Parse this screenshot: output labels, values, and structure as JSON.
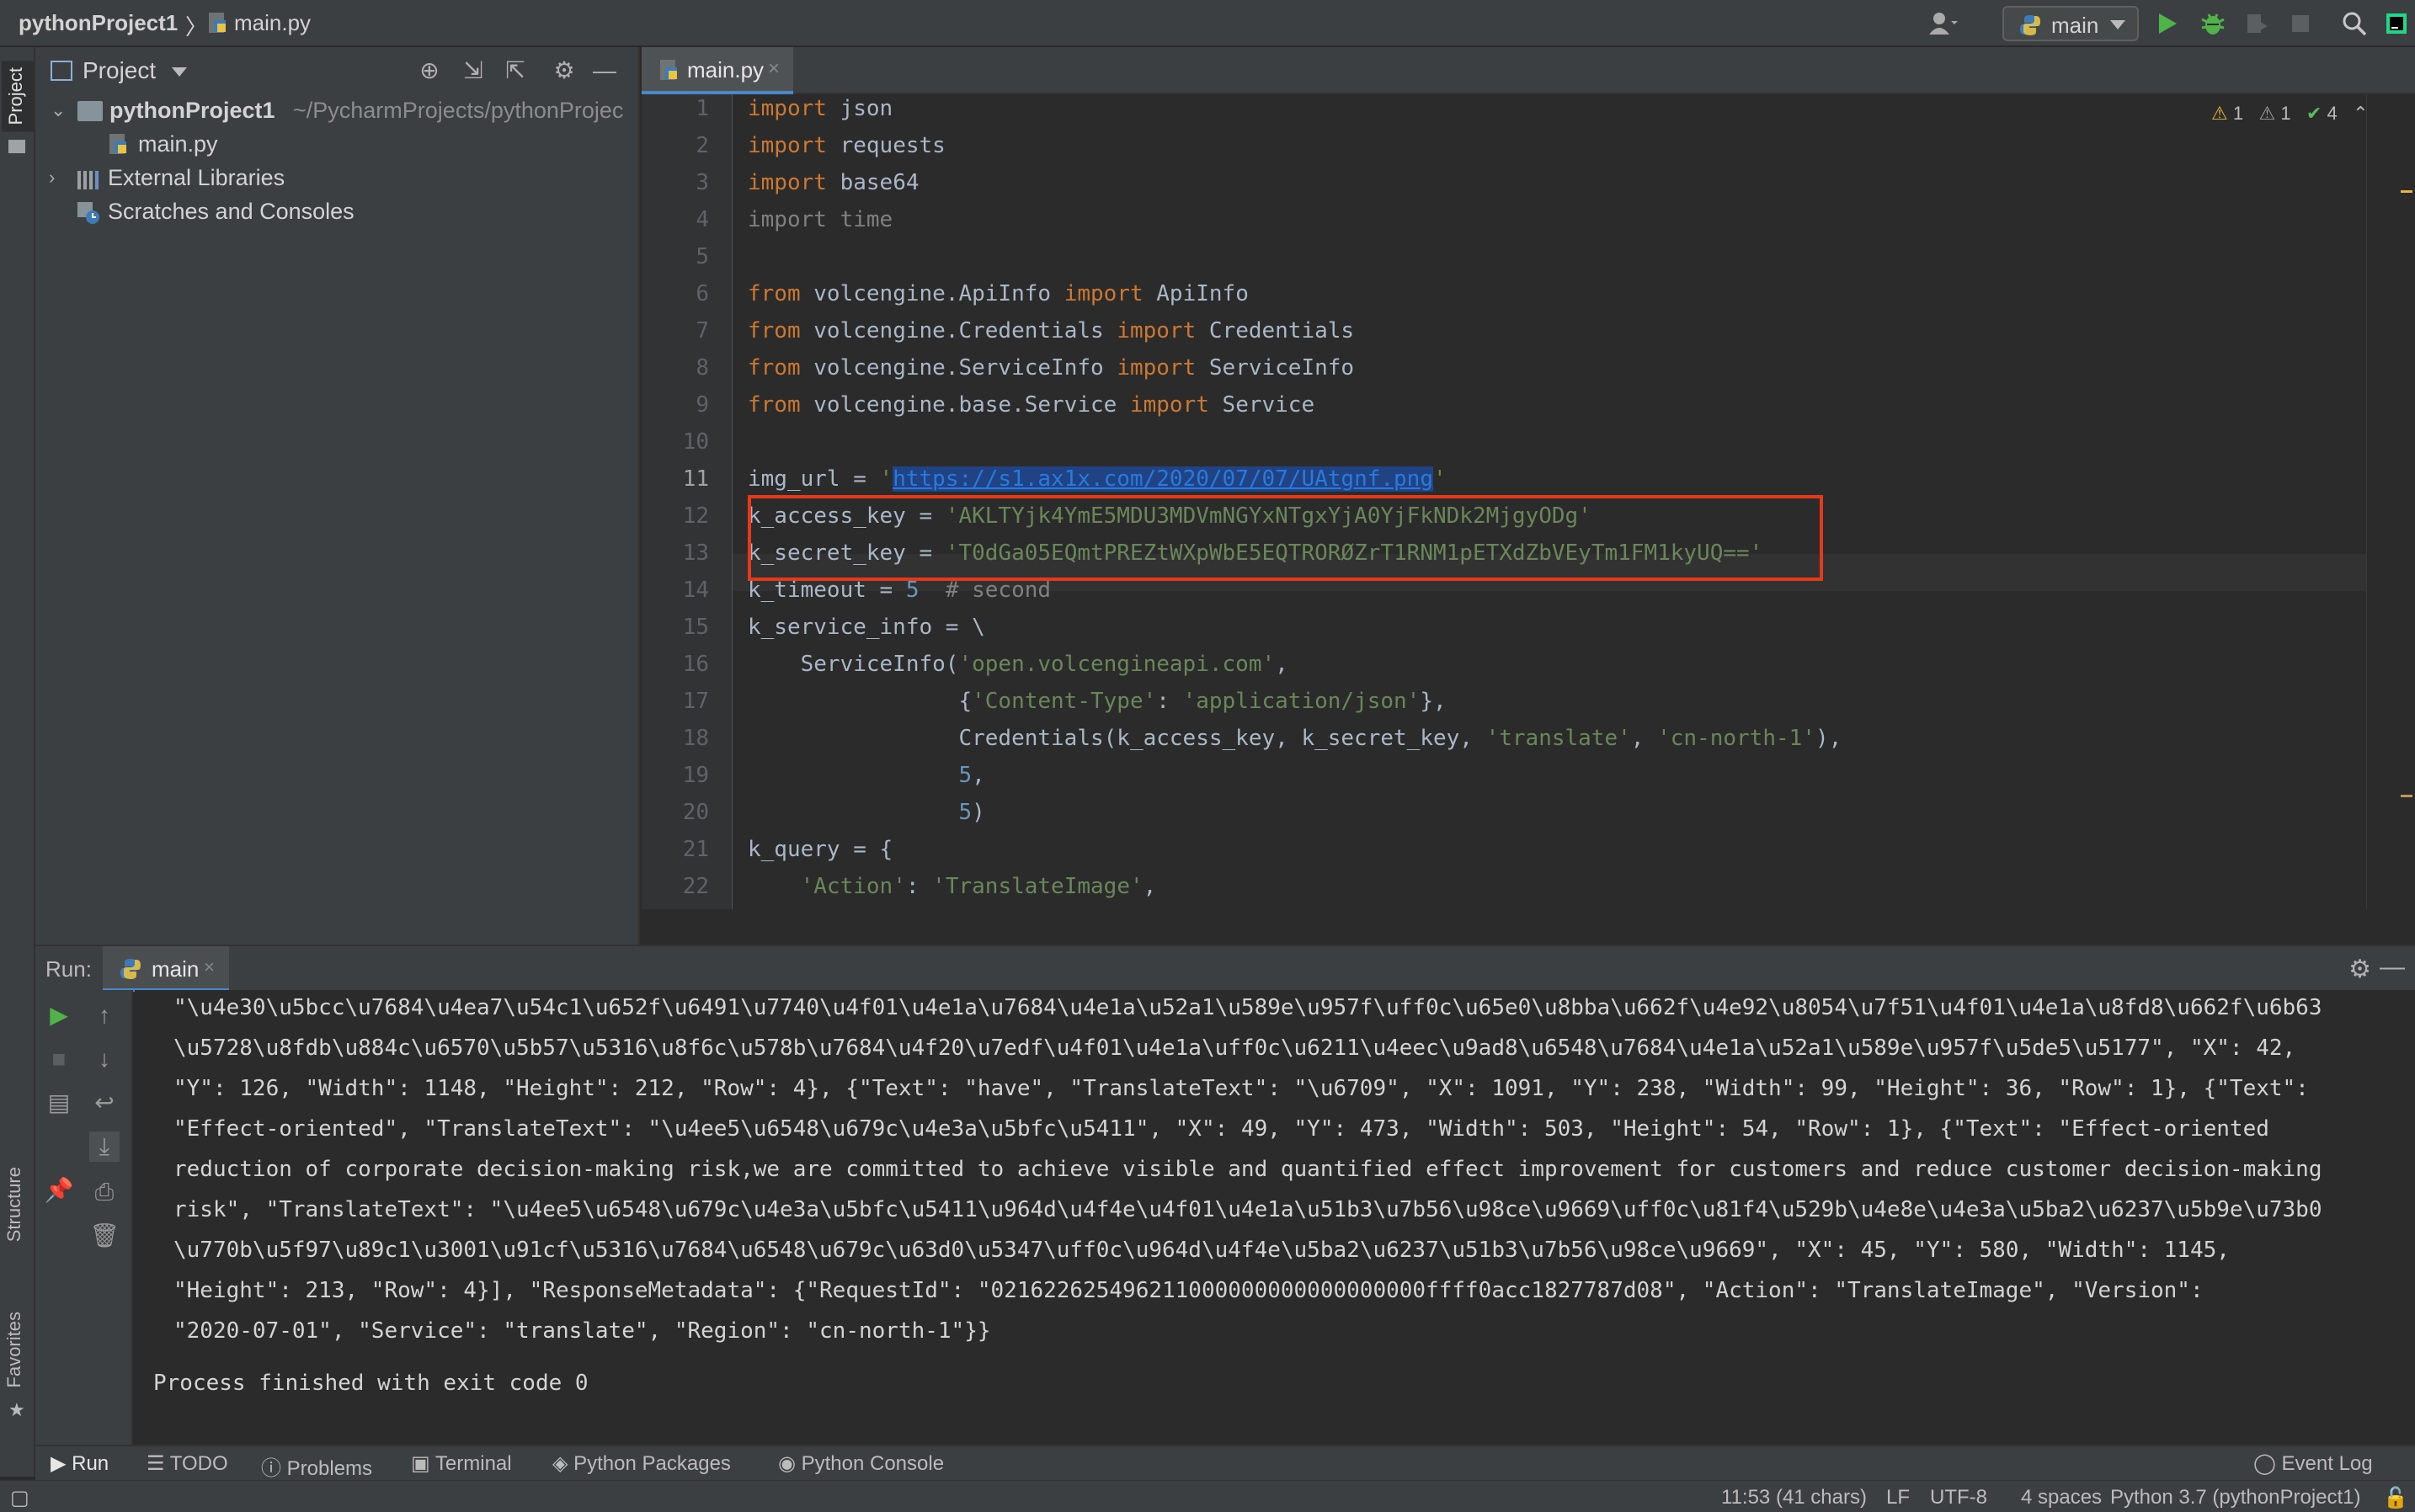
{
  "breadcrumb": {
    "project": "pythonProject1",
    "file": "main.py"
  },
  "toolbar": {
    "run_config": "main"
  },
  "left_strip": {
    "project_tab": "Project",
    "structure_tab": "Structure",
    "favorites_tab": "Favorites"
  },
  "project_panel": {
    "title": "Project",
    "root": {
      "name": "pythonProject1",
      "path": "~/PycharmProjects/pythonProjec"
    },
    "items": [
      {
        "label": "main.py"
      },
      {
        "label": "External Libraries"
      },
      {
        "label": "Scratches and Consoles"
      }
    ]
  },
  "editor": {
    "tab": "main.py",
    "current_line": 11,
    "inspections": {
      "warnings": "1",
      "weak_warnings": "1",
      "ok": "4"
    },
    "lines": [
      "import json",
      "import requests",
      "import base64",
      "import time",
      "",
      "from volcengine.ApiInfo import ApiInfo",
      "from volcengine.Credentials import Credentials",
      "from volcengine.ServiceInfo import ServiceInfo",
      "from volcengine.base.Service import Service",
      "",
      "img_url = 'https://s1.ax1x.com/2020/07/07/UAtgnf.png'",
      "k_access_key = 'AKLTYjk4YmE5MDU3MDVmNGYxNTgxYjA0YjFkNDk2MjgyODg'",
      "k_secret_key = 'T0dGa05EQmtPREZtWXpWbE5EQTRORØZrT1RNM1pETXdZbVEyTm1FM1kyUQ=='",
      "k_timeout = 5  # second",
      "k_service_info = \\",
      "    ServiceInfo('open.volcengineapi.com',",
      "                {'Content-Type': 'application/json'},",
      "                Credentials(k_access_key, k_secret_key, 'translate', 'cn-north-1'),",
      "                5,",
      "                5)",
      "k_query = {",
      "    'Action': 'TranslateImage',"
    ]
  },
  "run_panel": {
    "label": "Run:",
    "tab": "main",
    "output": [
      "\"\\u4e30\\u5bcc\\u7684\\u4ea7\\u54c1\\u652f\\u6491\\u7740\\u4f01\\u4e1a\\u7684\\u4e1a\\u52a1\\u589e\\u957f\\uff0c\\u65e0\\u8bba\\u662f\\u4e92\\u8054\\u7f51\\u4f01\\u4e1a\\u8fd8\\u662f\\u6b63",
      "\\u5728\\u8fdb\\u884c\\u6570\\u5b57\\u5316\\u8f6c\\u578b\\u7684\\u4f20\\u7edf\\u4f01\\u4e1a\\uff0c\\u6211\\u4eec\\u9ad8\\u6548\\u7684\\u4e1a\\u52a1\\u589e\\u957f\\u5de5\\u5177\", \"X\": 42,",
      "\"Y\": 126, \"Width\": 1148, \"Height\": 212, \"Row\": 4}, {\"Text\": \"have\", \"TranslateText\": \"\\u6709\", \"X\": 1091, \"Y\": 238, \"Width\": 99, \"Height\": 36, \"Row\": 1}, {\"Text\":",
      "\"Effect-oriented\", \"TranslateText\": \"\\u4ee5\\u6548\\u679c\\u4e3a\\u5bfc\\u5411\", \"X\": 49, \"Y\": 473, \"Width\": 503, \"Height\": 54, \"Row\": 1}, {\"Text\": \"Effect-oriented",
      "reduction of corporate decision-making risk,we are committed to achieve visible and quantified effect improvement for customers and reduce customer decision-making",
      "risk\", \"TranslateText\": \"\\u4ee5\\u6548\\u679c\\u4e3a\\u5bfc\\u5411\\u964d\\u4f4e\\u4f01\\u4e1a\\u51b3\\u7b56\\u98ce\\u9669\\uff0c\\u81f4\\u529b\\u4e8e\\u4e3a\\u5ba2\\u6237\\u5b9e\\u73b0",
      "\\u770b\\u5f97\\u89c1\\u3001\\u91cf\\u5316\\u7684\\u6548\\u679c\\u63d0\\u5347\\uff0c\\u964d\\u4f4e\\u5ba2\\u6237\\u51b3\\u7b56\\u98ce\\u9669\", \"X\": 45, \"Y\": 580, \"Width\": 1145,",
      "\"Height\": 213, \"Row\": 4}], \"ResponseMetadata\": {\"RequestId\": \"021622625496211000000000000000000ffff0acc1827787d08\", \"Action\": \"TranslateImage\", \"Version\":",
      "\"2020-07-01\", \"Service\": \"translate\", \"Region\": \"cn-north-1\"}}"
    ],
    "exit_message": "Process finished with exit code 0"
  },
  "bottom_tools": [
    "Run",
    "TODO",
    "Problems",
    "Terminal",
    "Python Packages",
    "Python Console",
    "Event Log"
  ],
  "status_bar": {
    "position": "11:53 (41 chars)",
    "line_sep": "LF",
    "encoding": "UTF-8",
    "indent": "4 spaces",
    "interpreter": "Python 3.7 (pythonProject1)"
  },
  "colors": {
    "highlight_box": "#e5391c",
    "accent": "#4a88c7",
    "keyword": "#cc7832",
    "string": "#6a8759"
  }
}
